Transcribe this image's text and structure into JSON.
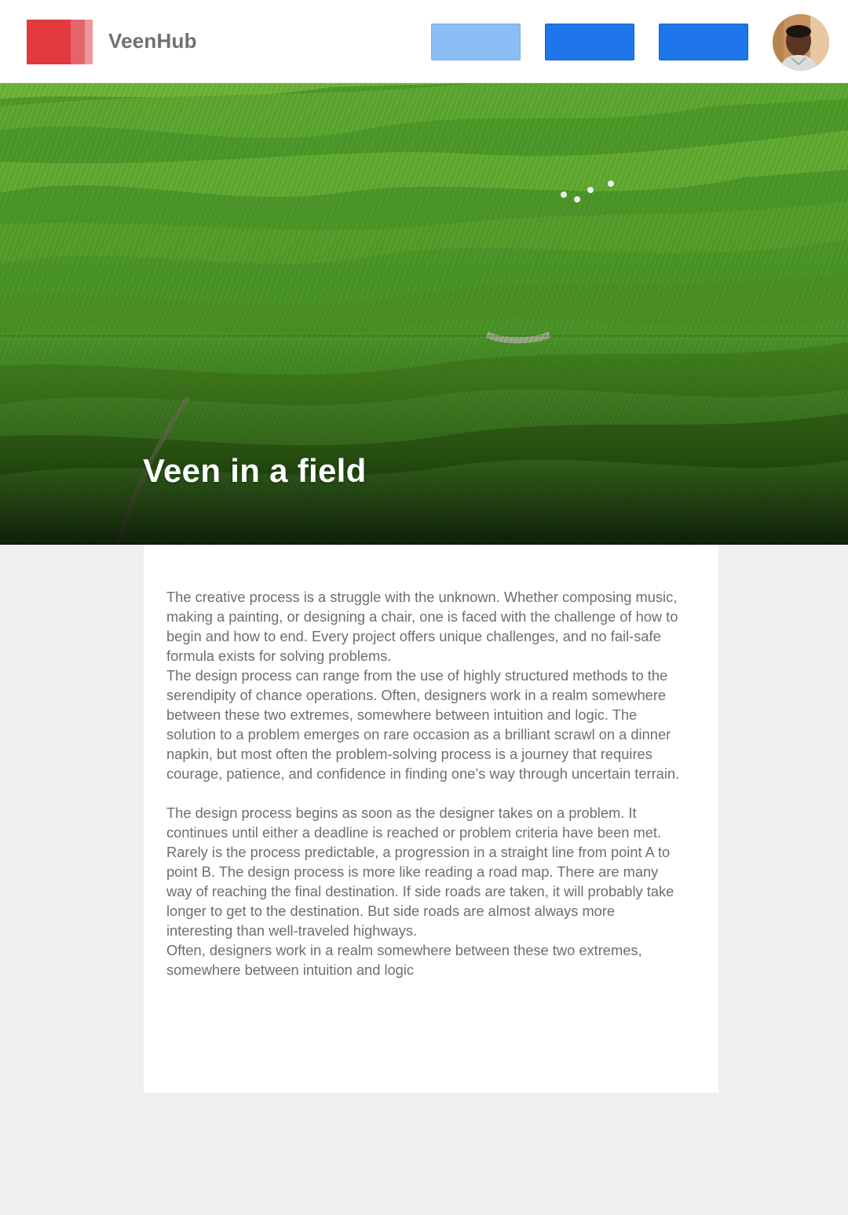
{
  "header": {
    "brand": "VeenHub"
  },
  "hero": {
    "title": "Veen in a field"
  },
  "article": {
    "paragraphs": [
      "The creative process is a struggle with the unknown. Whether composing music, making a painting, or designing a chair, one is faced with the challenge of how to begin and how to end. Every project offers unique challenges, and no fail-safe formula exists for solving problems.",
      "The design process can range from the use of highly structured methods to the serendipity of chance operations. Often, designers work in a realm somewhere between these two extremes, somewhere between intuition and logic. The solution to a problem emerges on rare occasion as a brilliant scrawl on a dinner napkin, but most often the problem-solving process is a journey that requires courage, patience, and confidence in finding one’s way through uncertain terrain.",
      "The design process begins as soon as the designer takes on a problem. It continues until either a deadline is reached or problem criteria have been met. Rarely is the process predictable, a progression in a straight line from point A to point B. The design process is more like reading a road map. There are many way of reaching the final destination. If side roads are taken, it will probably take longer to get to the destination. But side roads are almost always more interesting than well-traveled highways.",
      "Often, designers work in a realm somewhere between these two extremes, somewhere between intuition and logic"
    ]
  },
  "colors": {
    "logo_red": "#e2393e",
    "button_light_blue": "#8dbdf6",
    "button_blue": "#1e76ea",
    "text_gray": "#6e6e6e",
    "page_background": "#efefef"
  }
}
